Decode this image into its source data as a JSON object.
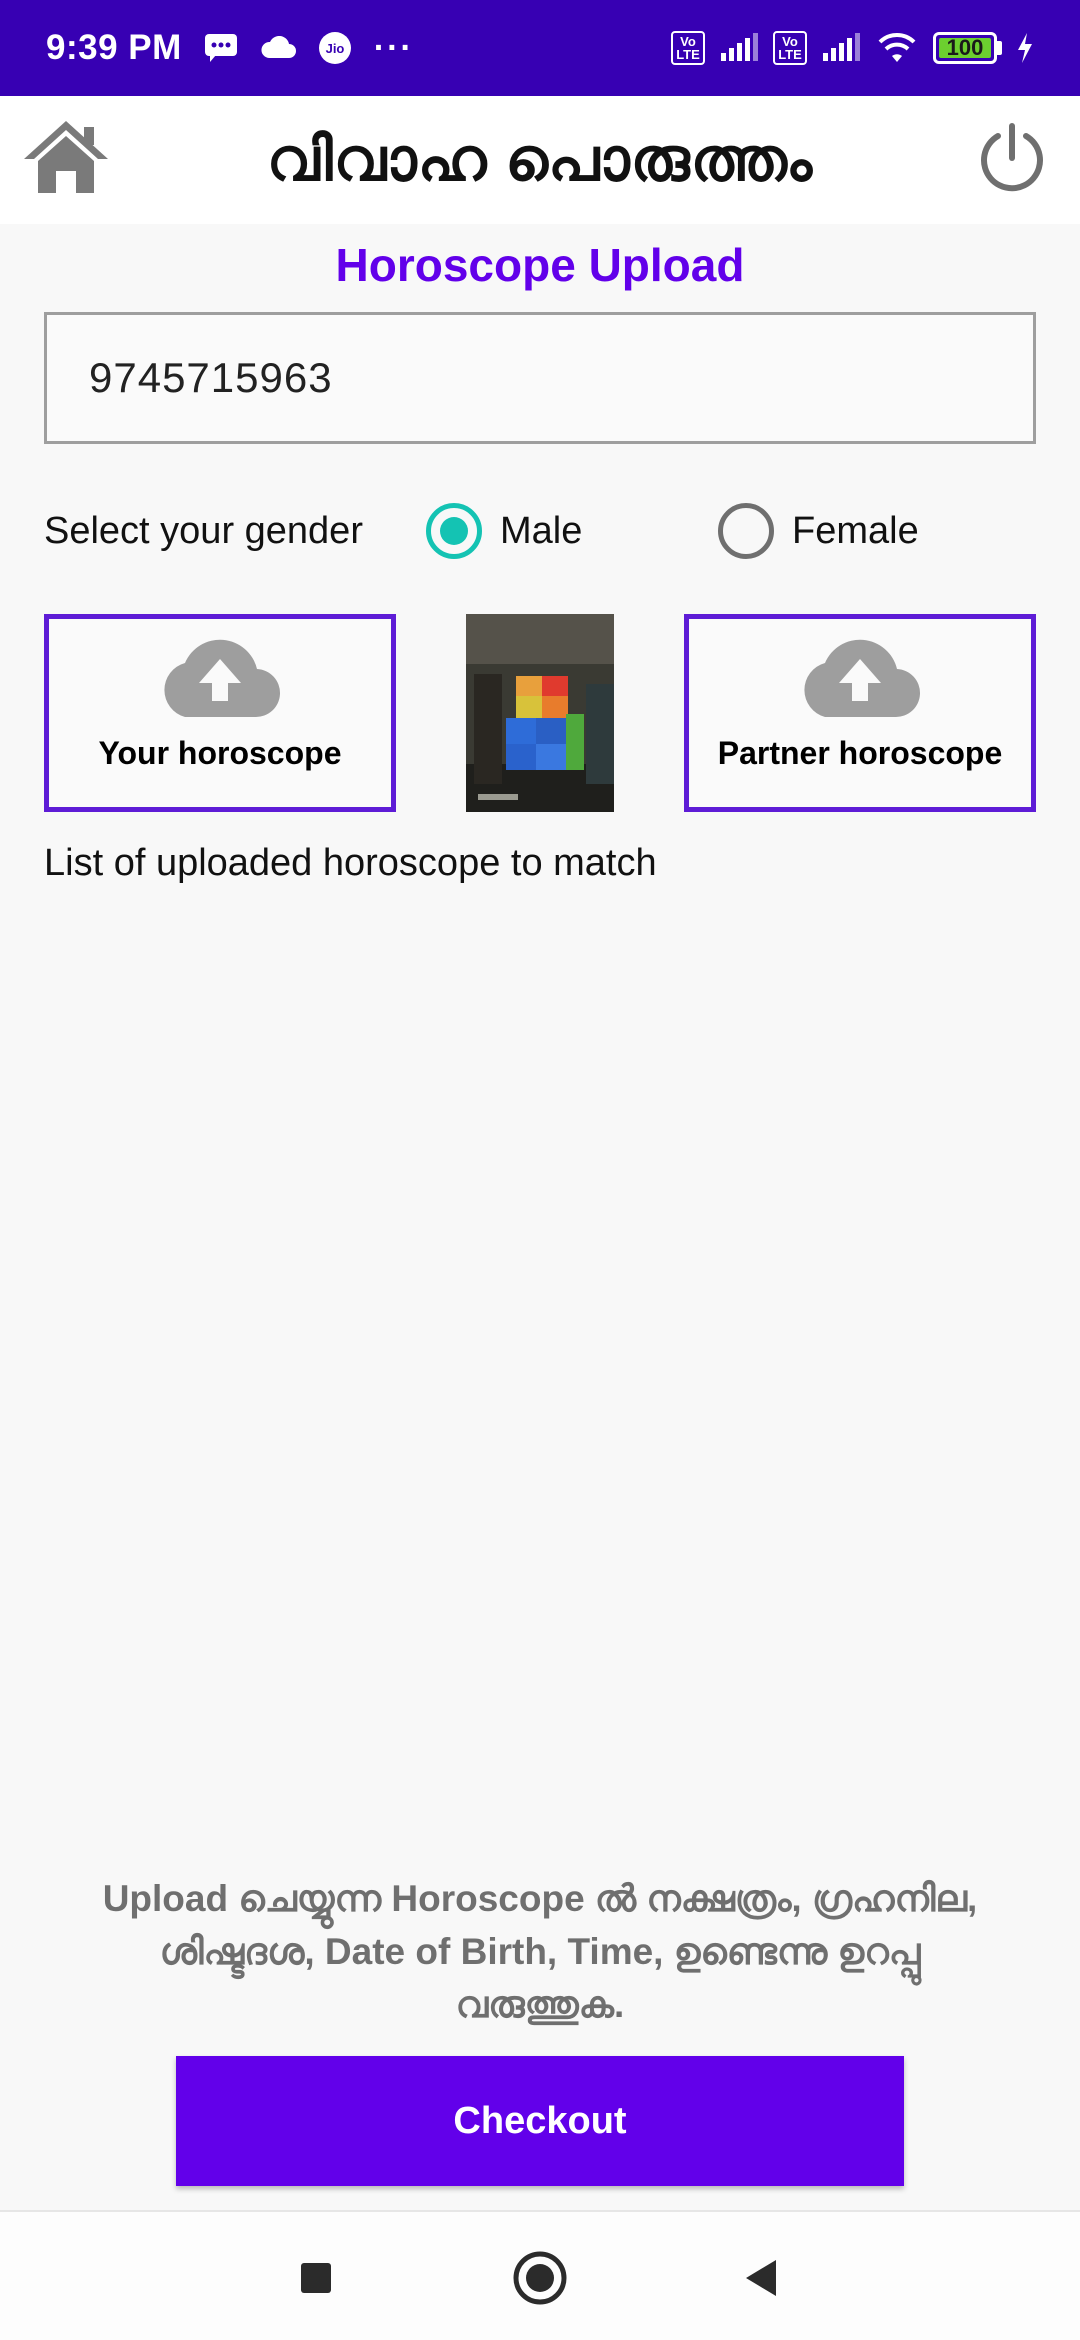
{
  "status_bar": {
    "time": "9:39 PM",
    "jio_label": "Jio",
    "more": "···",
    "volte_1": "Vo LTE",
    "volte_2": "Vo LTE",
    "battery": "100"
  },
  "app_bar": {
    "title": "വിവാഹ പൊരുത്തം",
    "home_icon": "home-icon",
    "power_icon": "power-icon"
  },
  "main": {
    "section_title": "Horoscope Upload",
    "phone_value": "9745715963",
    "gender_label": "Select your gender",
    "gender_options": [
      "Male",
      "Female"
    ],
    "gender_selected": "Male",
    "your_horoscope_label": "Your horoscope",
    "partner_horoscope_label": "Partner horoscope",
    "list_caption": "List of uploaded horoscope to match",
    "note": "Upload ചെയ്യുന്ന Horoscope ൽ നക്ഷത്രം, ഗ്രഹനില, ശിഷ്ടദശ, Date of Birth, Time, ഉണ്ടെന്നു ഉറപ്പു വരുത്തുക.",
    "checkout_label": "Checkout"
  },
  "colors": {
    "status_bar": "#3700b3",
    "accent": "#6200ea",
    "radio_checked": "#14c3b3",
    "upload_border": "#5e1cd6"
  }
}
